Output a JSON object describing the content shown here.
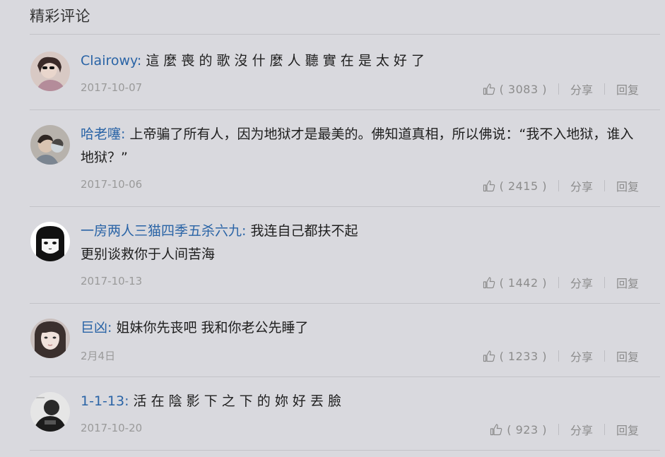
{
  "section": {
    "title": "精彩评论"
  },
  "labels": {
    "share": "分享",
    "reply": "回复"
  },
  "comments": [
    {
      "nickname": "Clairowy",
      "text": "這 麼 喪 的 歌 沒 什 麼 人 聽 實 在 是 太 好 了",
      "date": "2017-10-07",
      "likes": "( 3083 )"
    },
    {
      "nickname": "哈老噻",
      "text": "上帝骗了所有人，因为地狱才是最美的。佛知道真相，所以佛说：“我不入地狱，谁入地狱？”",
      "date": "2017-10-06",
      "likes": "( 2415 )"
    },
    {
      "nickname": "一房两人三猫四季五杀六九",
      "text": "我连自己都扶不起",
      "text2": "更别谈救你于人间苦海",
      "date": "2017-10-13",
      "likes": "( 1442 )"
    },
    {
      "nickname": "巨凶",
      "text": "姐妹你先丧吧 我和你老公先睡了",
      "date": "2月4日",
      "likes": "( 1233 )"
    },
    {
      "nickname": "1-1-13",
      "text": "活 在 陰 影 下 之 下 的 妳 好 丟 臉",
      "date": "2017-10-20",
      "likes": "( 923 )"
    }
  ]
}
